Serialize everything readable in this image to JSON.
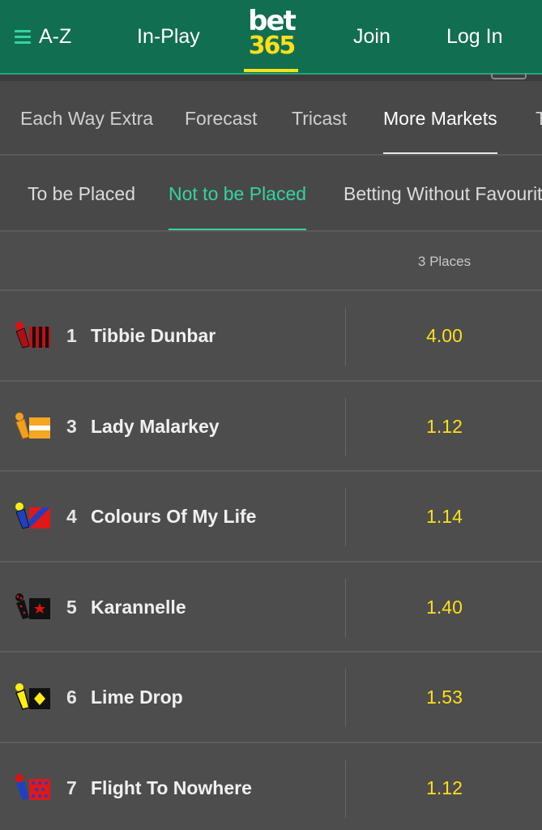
{
  "header": {
    "az_label": "A-Z",
    "inplay_label": "In-Play",
    "logo_top": "bet",
    "logo_bottom": "365",
    "join_label": "Join",
    "login_label": "Log In"
  },
  "market_tabs": [
    {
      "label": "Each Way Extra"
    },
    {
      "label": "Forecast"
    },
    {
      "label": "Tricast"
    },
    {
      "label": "More Markets",
      "active": true
    },
    {
      "label": "T"
    }
  ],
  "sub_tabs": [
    {
      "label": "To be Placed"
    },
    {
      "label": "Not to be Placed",
      "active": true
    },
    {
      "label": "Betting Without Favourite"
    }
  ],
  "column_header": {
    "places": "3 Places"
  },
  "runners": [
    {
      "number": "1",
      "name": "Tibbie Dunbar",
      "odds": "4.00",
      "silk": "red-black-stripes"
    },
    {
      "number": "3",
      "name": "Lady Malarkey",
      "odds": "1.12",
      "silk": "orange-white-hoop"
    },
    {
      "number": "4",
      "name": "Colours Of My Life",
      "odds": "1.14",
      "silk": "red-blue-diagonal"
    },
    {
      "number": "5",
      "name": "Karannelle",
      "odds": "1.40",
      "silk": "black-red-star"
    },
    {
      "number": "6",
      "name": "Lime Drop",
      "odds": "1.53",
      "silk": "black-yellow-diamond"
    },
    {
      "number": "7",
      "name": "Flight To Nowhere",
      "odds": "1.12",
      "silk": "red-blue-spots"
    }
  ],
  "colors": {
    "header_green": "#126e51",
    "accent_green": "#35d3a1",
    "odds_yellow": "#ffdf1b",
    "background": "#4d4d4d"
  }
}
